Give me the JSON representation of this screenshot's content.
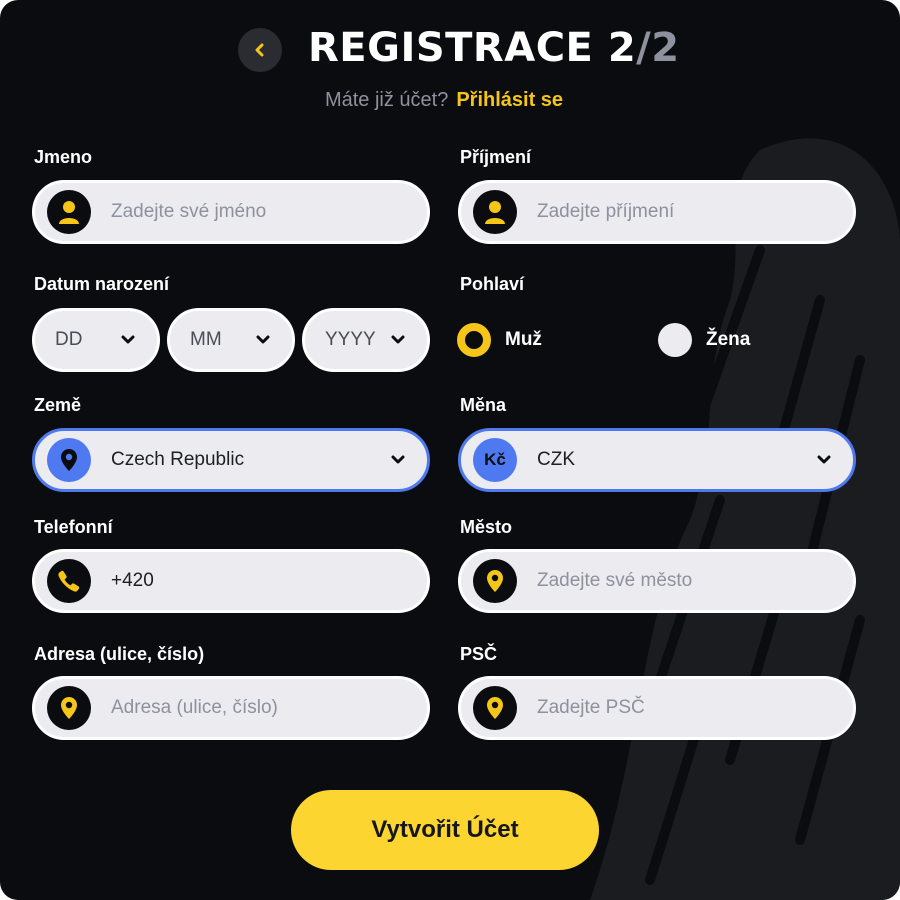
{
  "header": {
    "title": "REGISTRACE",
    "step_current": "2",
    "step_separator": "/",
    "step_total": "2",
    "subtitle_question": "Máte již účet?",
    "login_link": "Přihlásit se"
  },
  "fields": {
    "first_name": {
      "label": "Jmeno",
      "placeholder": "Zadejte své jméno",
      "icon": "user-icon"
    },
    "last_name": {
      "label": "Příjmení",
      "placeholder": "Zadejte příjmení",
      "icon": "user-icon"
    },
    "birth_date": {
      "label": "Datum narození",
      "day": "DD",
      "month": "MM",
      "year": "YYYY"
    },
    "gender": {
      "label": "Pohlaví",
      "options": [
        "Muž",
        "Žena"
      ],
      "selected": "Muž"
    },
    "country": {
      "label": "Země",
      "value": "Czech Republic",
      "icon": "location-pin-icon"
    },
    "currency": {
      "label": "Měna",
      "value": "CZK",
      "icon_text": "Kč"
    },
    "phone": {
      "label": "Telefonní",
      "value": "+420",
      "icon": "phone-icon"
    },
    "city": {
      "label": "Město",
      "placeholder": "Zadejte své město",
      "icon": "location-pin-icon"
    },
    "address": {
      "label": "Adresa (ulice, číslo)",
      "placeholder": "Adresa (ulice, číslo)",
      "icon": "location-pin-icon"
    },
    "postal_code": {
      "label": "PSČ",
      "placeholder": "Zadejte PSČ",
      "icon": "location-pin-icon"
    }
  },
  "submit_label": "Vytvořit Účet",
  "colors": {
    "background": "#0b0c0f",
    "accent_yellow": "#f5c518",
    "accent_blue": "#4e79f0",
    "input_bg": "#ebebf0",
    "muted_text": "#8d929e"
  }
}
